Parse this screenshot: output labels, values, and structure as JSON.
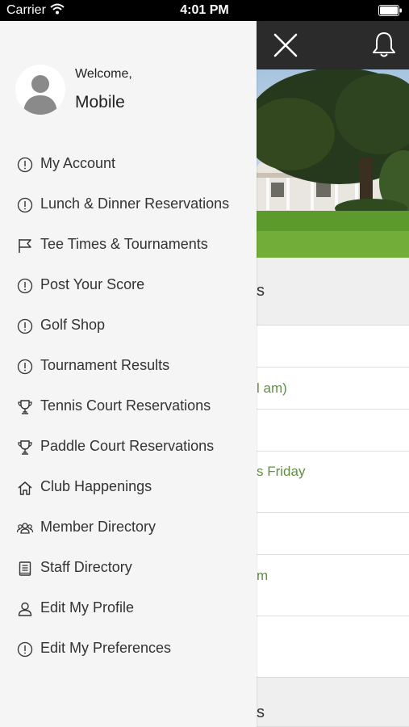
{
  "status_bar": {
    "carrier": "Carrier",
    "time": "4:01 PM"
  },
  "drawer": {
    "welcome": "Welcome,",
    "user_name": "Mobile",
    "items": [
      {
        "label": "My Account",
        "icon": "info-circle-icon"
      },
      {
        "label": "Lunch & Dinner Reservations",
        "icon": "info-circle-icon"
      },
      {
        "label": "Tee Times & Tournaments",
        "icon": "flag-icon"
      },
      {
        "label": "Post Your Score",
        "icon": "info-circle-icon"
      },
      {
        "label": "Golf Shop",
        "icon": "info-circle-icon"
      },
      {
        "label": "Tournament Results",
        "icon": "info-circle-icon"
      },
      {
        "label": "Tennis Court Reservations",
        "icon": "trophy-icon"
      },
      {
        "label": "Paddle Court Reservations",
        "icon": "trophy-icon"
      },
      {
        "label": "Club Happenings",
        "icon": "home-icon"
      },
      {
        "label": "Member Directory",
        "icon": "group-icon"
      },
      {
        "label": "Staff Directory",
        "icon": "book-icon"
      },
      {
        "label": "Edit My Profile",
        "icon": "user-icon"
      },
      {
        "label": "Edit My Preferences",
        "icon": "info-circle-icon"
      }
    ]
  },
  "background": {
    "section1": "s",
    "rows": [
      "",
      "l am)",
      "",
      "s Friday",
      "",
      "m",
      ""
    ],
    "section2": "s"
  },
  "colors": {
    "drawer_bg": "#f5f5f5",
    "header_bg": "#2b2b2b",
    "accent_green": "#5f8f43"
  }
}
